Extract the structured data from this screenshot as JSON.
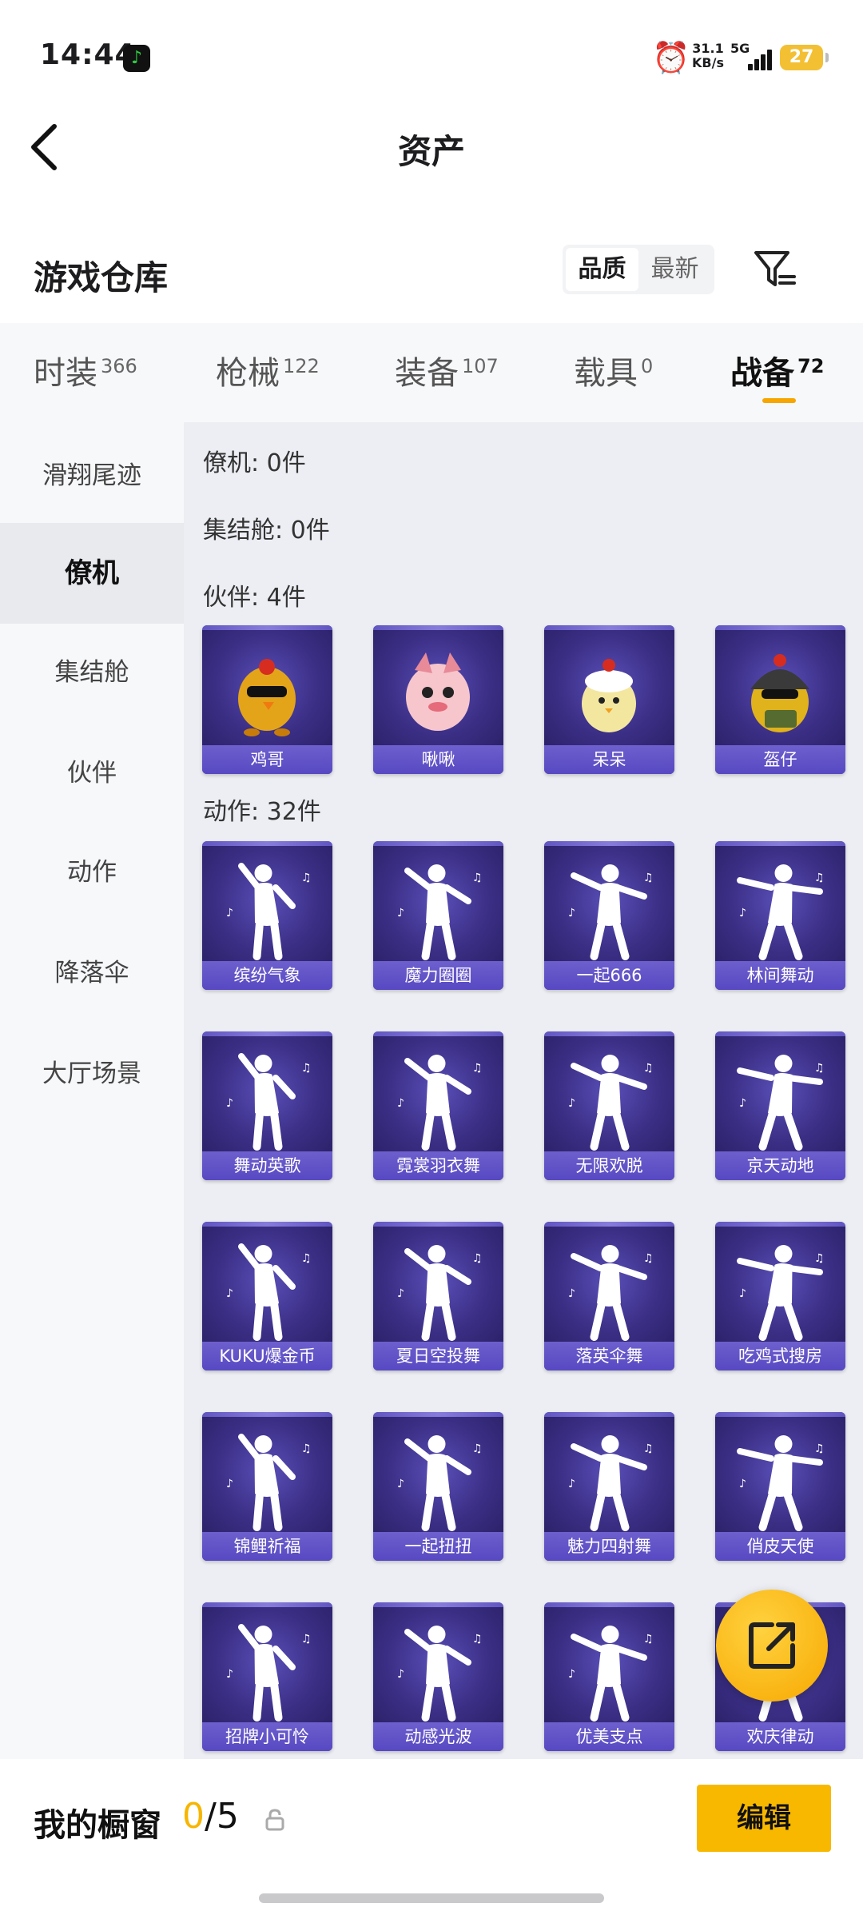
{
  "status_bar": {
    "time": "14:44",
    "net_speed_value": "31.1",
    "net_speed_unit": "KB/s",
    "network": "5G",
    "battery": "27"
  },
  "header": {
    "title": "资产"
  },
  "warehouse": {
    "title": "游戏仓库",
    "sort_options": [
      "品质",
      "最新"
    ],
    "active_sort": "品质"
  },
  "tabs": [
    {
      "label": "时装",
      "count": "366"
    },
    {
      "label": "枪械",
      "count": "122"
    },
    {
      "label": "装备",
      "count": "107"
    },
    {
      "label": "载具",
      "count": "0"
    },
    {
      "label": "战备",
      "count": "72"
    }
  ],
  "active_tab": "战备",
  "sidebar": {
    "items": [
      "滑翔尾迹",
      "僚机",
      "集结舱",
      "伙伴",
      "动作",
      "降落伞",
      "大厅场景"
    ],
    "active": "僚机"
  },
  "groups": {
    "wingman": "僚机: 0件",
    "capsule": "集结舱: 0件",
    "partner": "伙伴: 4件",
    "emote": "动作: 32件"
  },
  "partners": [
    "鸡哥",
    "啾啾",
    "呆呆",
    "盔仔"
  ],
  "emotes": [
    "缤纷气象",
    "魔力圈圈",
    "一起666",
    "林间舞动",
    "舞动英歌",
    "霓裳羽衣舞",
    "无限欢脱",
    "京天动地",
    "KUKU爆金币",
    "夏日空投舞",
    "落英伞舞",
    "吃鸡式搜房",
    "锦鲤祈福",
    "一起扭扭",
    "魅力四射舞",
    "俏皮天使",
    "招牌小可怜",
    "动感光波",
    "优美支点",
    "欢庆律动"
  ],
  "bottom": {
    "label": "我的橱窗",
    "current": "0",
    "total": "/5",
    "edit": "编辑"
  },
  "colors": {
    "accent": "#f8b800",
    "card_bg": "#3b2f86"
  }
}
